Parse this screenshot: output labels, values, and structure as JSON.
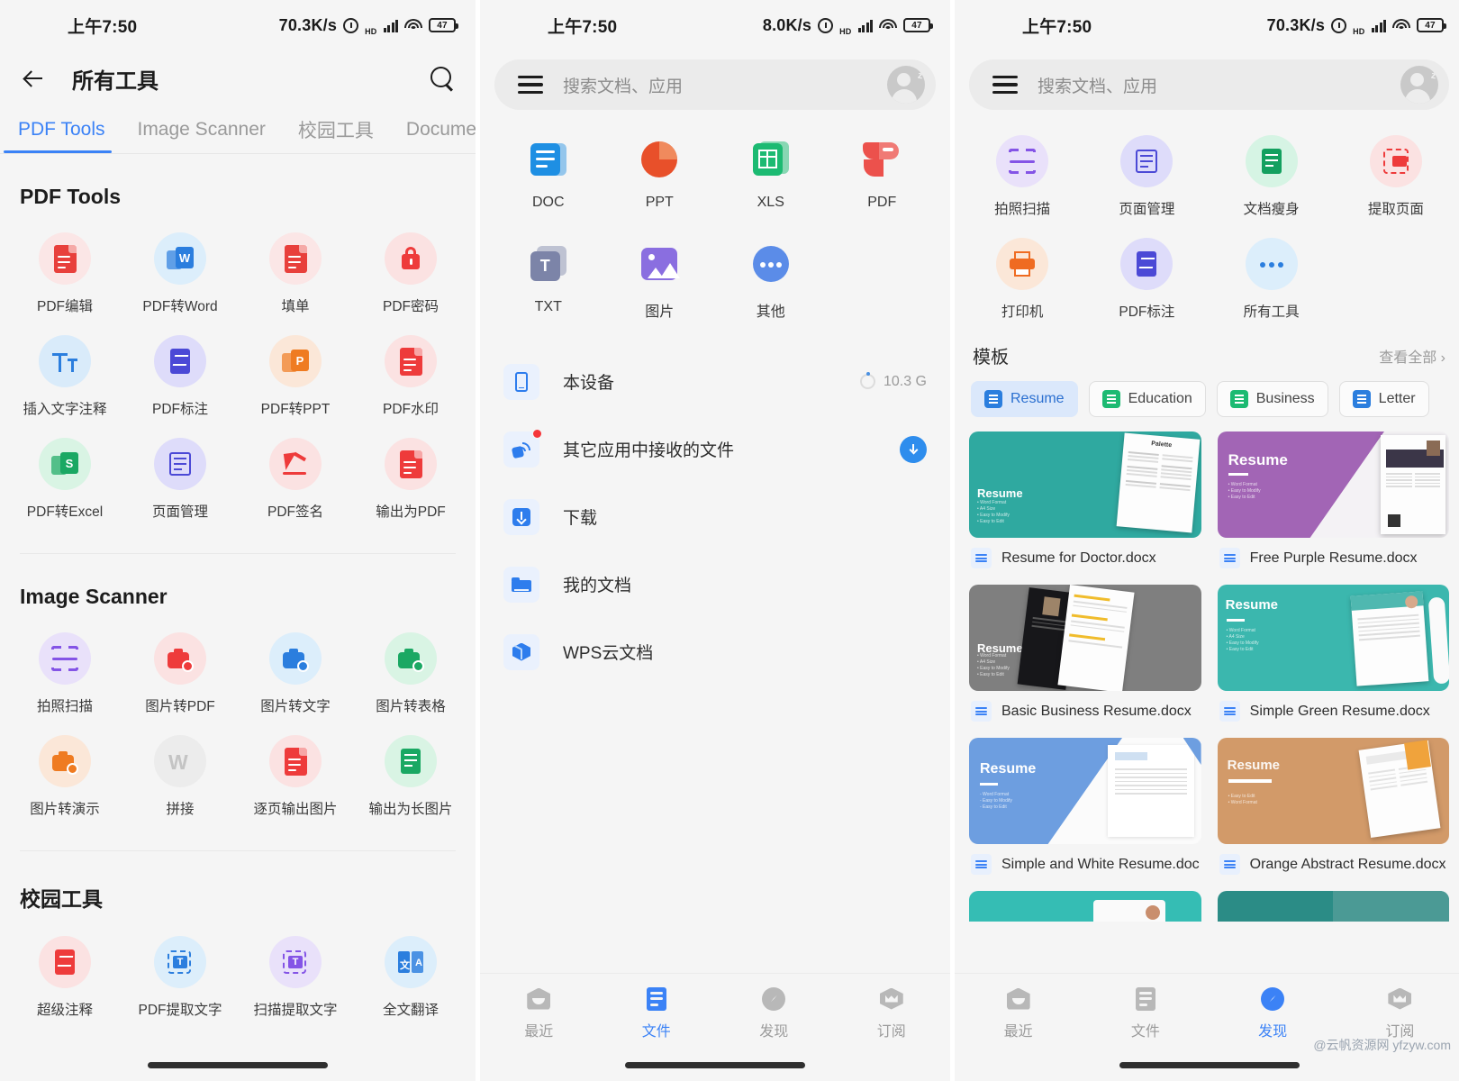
{
  "panel1": {
    "status": {
      "time": "上午7:50",
      "speed": "70.3K/s",
      "battery": "47"
    },
    "header": {
      "title": "所有工具",
      "back_icon": "back-arrow-icon",
      "search_icon": "search-icon"
    },
    "tabs": [
      {
        "label": "PDF Tools",
        "active": true
      },
      {
        "label": "Image Scanner",
        "active": false
      },
      {
        "label": "校园工具",
        "active": false
      },
      {
        "label": "Document",
        "active": false
      }
    ],
    "sections": [
      {
        "title": "PDF Tools",
        "tools": [
          {
            "label": "PDF编辑",
            "icon": "pdf-edit-icon",
            "bg": "#fbe6e6",
            "fg": "#e8403c"
          },
          {
            "label": "PDF转Word",
            "icon": "pdf-to-word-icon",
            "bg": "#dceefb",
            "fg": "#2b7ede"
          },
          {
            "label": "填单",
            "icon": "fill-form-icon",
            "bg": "#fbe6e6",
            "fg": "#e8403c"
          },
          {
            "label": "PDF密码",
            "icon": "pdf-password-lock-icon",
            "bg": "#fbe2e2",
            "fg": "#ee3b3b"
          },
          {
            "label": "插入文字注释",
            "icon": "insert-text-icon",
            "bg": "#d9ebfa",
            "fg": "#2b7ede"
          },
          {
            "label": "PDF标注",
            "icon": "pdf-annotate-icon",
            "bg": "#dedcfa",
            "fg": "#4b49d6"
          },
          {
            "label": "PDF转PPT",
            "icon": "pdf-to-ppt-icon",
            "bg": "#fbe7d8",
            "fg": "#ef7b21"
          },
          {
            "label": "PDF水印",
            "icon": "pdf-watermark-icon",
            "bg": "#fbe2e2",
            "fg": "#ee3b3b"
          },
          {
            "label": "PDF转Excel",
            "icon": "pdf-to-excel-icon",
            "bg": "#d9f4e4",
            "fg": "#1aa863"
          },
          {
            "label": "页面管理",
            "icon": "page-manage-icon",
            "bg": "#dedcfa",
            "fg": "#4b49d6"
          },
          {
            "label": "PDF签名",
            "icon": "pdf-sign-icon",
            "bg": "#fbe2e2",
            "fg": "#ee3b3b"
          },
          {
            "label": "输出为PDF",
            "icon": "export-pdf-icon",
            "bg": "#fbe2e2",
            "fg": "#ee3b3b"
          }
        ]
      },
      {
        "title": "Image Scanner",
        "tools": [
          {
            "label": "拍照扫描",
            "icon": "camera-scan-icon",
            "bg": "#e9e1fa",
            "fg": "#8454e6"
          },
          {
            "label": "图片转PDF",
            "icon": "image-to-pdf-icon",
            "bg": "#fbe2e2",
            "fg": "#ee3b3b"
          },
          {
            "label": "图片转文字",
            "icon": "image-to-text-icon",
            "bg": "#dceefb",
            "fg": "#2b7ede"
          },
          {
            "label": "图片转表格",
            "icon": "image-to-table-icon",
            "bg": "#d9f4e4",
            "fg": "#1aa863"
          },
          {
            "label": "图片转演示",
            "icon": "image-to-ppt-icon",
            "bg": "#fbe7d8",
            "fg": "#ef7b21"
          },
          {
            "label": "拼接",
            "icon": "stitch-wps-icon",
            "bg": "#ececec",
            "fg": "#c4c4c4"
          },
          {
            "label": "逐页输出图片",
            "icon": "export-page-image-icon",
            "bg": "#fbe2e2",
            "fg": "#ee3b3b"
          },
          {
            "label": "输出为长图片",
            "icon": "export-long-image-icon",
            "bg": "#d9f4e4",
            "fg": "#1aa863"
          }
        ]
      },
      {
        "title": "校园工具",
        "tools": [
          {
            "label": "超级注释",
            "icon": "super-annotate-icon",
            "bg": "#fbe2e2",
            "fg": "#ee3b3b"
          },
          {
            "label": "PDF提取文字",
            "icon": "pdf-extract-text-icon",
            "bg": "#dceefb",
            "fg": "#2b7ede"
          },
          {
            "label": "扫描提取文字",
            "icon": "scan-extract-text-icon",
            "bg": "#e9e1fa",
            "fg": "#8454e6"
          },
          {
            "label": "全文翻译",
            "icon": "translate-icon",
            "bg": "#dceefb",
            "fg": "#2b7ede"
          }
        ]
      }
    ]
  },
  "panel2": {
    "status": {
      "time": "上午7:50",
      "speed": "8.0K/s",
      "battery": "47"
    },
    "search": {
      "placeholder": "搜索文档、应用",
      "menu_icon": "hamburger-menu-icon",
      "avatar_icon": "user-avatar-sleeping-icon"
    },
    "filetypes": [
      {
        "label": "DOC",
        "icon": "doc-file-icon",
        "color": "#1e8fe3"
      },
      {
        "label": "PPT",
        "icon": "ppt-file-icon",
        "color": "#e8502a"
      },
      {
        "label": "XLS",
        "icon": "xls-file-icon",
        "color": "#1cba72"
      },
      {
        "label": "PDF",
        "icon": "pdf-file-icon",
        "color": "#ec514c"
      },
      {
        "label": "TXT",
        "icon": "txt-file-icon",
        "color": "#7c84a8"
      },
      {
        "label": "图片",
        "icon": "image-file-icon",
        "color": "#8a6ee0"
      },
      {
        "label": "其他",
        "icon": "other-file-icon",
        "color": "#5b8ce8"
      }
    ],
    "locations": [
      {
        "label": "本设备",
        "icon": "phone-icon",
        "size": "10.3 G",
        "has_ring": true,
        "has_download": false,
        "badge": false
      },
      {
        "label": "其它应用中接收的文件",
        "icon": "received-files-icon",
        "size": "",
        "has_ring": false,
        "has_download": true,
        "badge": true
      },
      {
        "label": "下载",
        "icon": "download-icon",
        "size": "",
        "has_ring": false,
        "has_download": false,
        "badge": false
      },
      {
        "label": "我的文档",
        "icon": "folder-icon",
        "size": "",
        "has_ring": false,
        "has_download": false,
        "badge": false
      },
      {
        "label": "WPS云文档",
        "icon": "cloud-cube-icon",
        "size": "",
        "has_ring": false,
        "has_download": false,
        "badge": false
      }
    ],
    "bottomnav": [
      {
        "label": "最近",
        "icon": "recent-icon",
        "active": false
      },
      {
        "label": "文件",
        "icon": "files-icon",
        "active": true
      },
      {
        "label": "发现",
        "icon": "discover-compass-icon",
        "active": false
      },
      {
        "label": "订阅",
        "icon": "subscribe-crown-icon",
        "active": false
      }
    ]
  },
  "panel3": {
    "status": {
      "time": "上午7:50",
      "speed": "70.3K/s",
      "battery": "47"
    },
    "search": {
      "placeholder": "搜索文档、应用",
      "menu_icon": "hamburger-menu-icon",
      "avatar_icon": "user-avatar-sleeping-icon"
    },
    "tools": [
      {
        "label": "拍照扫描",
        "icon": "camera-scan-icon",
        "bg": "#e9e1fa",
        "fg": "#8454e6"
      },
      {
        "label": "页面管理",
        "icon": "page-manage-icon",
        "bg": "#dedcfa",
        "fg": "#4b49d6"
      },
      {
        "label": "文档瘦身",
        "icon": "document-compress-icon",
        "bg": "#d6f4e4",
        "fg": "#13a05f"
      },
      {
        "label": "提取页面",
        "icon": "extract-page-icon",
        "bg": "#fbe2e2",
        "fg": "#ee3b3b"
      },
      {
        "label": "打印机",
        "icon": "printer-icon",
        "bg": "#fbe7d8",
        "fg": "#ef6b21"
      },
      {
        "label": "PDF标注",
        "icon": "pdf-annotate-icon",
        "bg": "#dedcfa",
        "fg": "#4b49d6"
      },
      {
        "label": "所有工具",
        "icon": "all-tools-icon",
        "bg": "#dceefb",
        "fg": "#2b7ede"
      }
    ],
    "templates_header": {
      "title": "模板",
      "view_all": "查看全部"
    },
    "categories": [
      {
        "label": "Resume",
        "active": true,
        "color": "#2b7ede"
      },
      {
        "label": "Education",
        "active": false,
        "color": "#1cba72"
      },
      {
        "label": "Business",
        "active": false,
        "color": "#1cba72"
      },
      {
        "label": "Letter",
        "active": false,
        "color": "#2b7ede"
      }
    ],
    "templates": [
      {
        "name": "Resume for Doctor.docx",
        "accent": "#2fa9a0",
        "style": "teal-palette"
      },
      {
        "name": "Free Purple Resume.docx",
        "accent": "#a265b5",
        "style": "purple-diag"
      },
      {
        "name": "Basic Business Resume.docx",
        "accent": "#7f7f7f",
        "style": "gray-dark"
      },
      {
        "name": "Simple Green Resume.docx",
        "accent": "#3bb7ae",
        "style": "teal-flat"
      },
      {
        "name": "Simple and White Resume.doc",
        "accent": "#6d9ee0",
        "style": "blue-diag"
      },
      {
        "name": "Orange Abstract Resume.docx",
        "accent": "#d29a69",
        "style": "tan-flat"
      },
      {
        "name": "",
        "accent": "#35bdb4",
        "style": "teal-partial"
      },
      {
        "name": "",
        "accent": "#2b8c86",
        "style": "darkteal-partial"
      }
    ],
    "bottomnav": [
      {
        "label": "最近",
        "icon": "recent-icon",
        "active": false
      },
      {
        "label": "文件",
        "icon": "files-icon",
        "active": false
      },
      {
        "label": "发现",
        "icon": "discover-compass-icon",
        "active": true
      },
      {
        "label": "订阅",
        "icon": "subscribe-crown-icon",
        "active": false
      }
    ],
    "watermark": "@云帆资源网 yfzyw.com"
  }
}
